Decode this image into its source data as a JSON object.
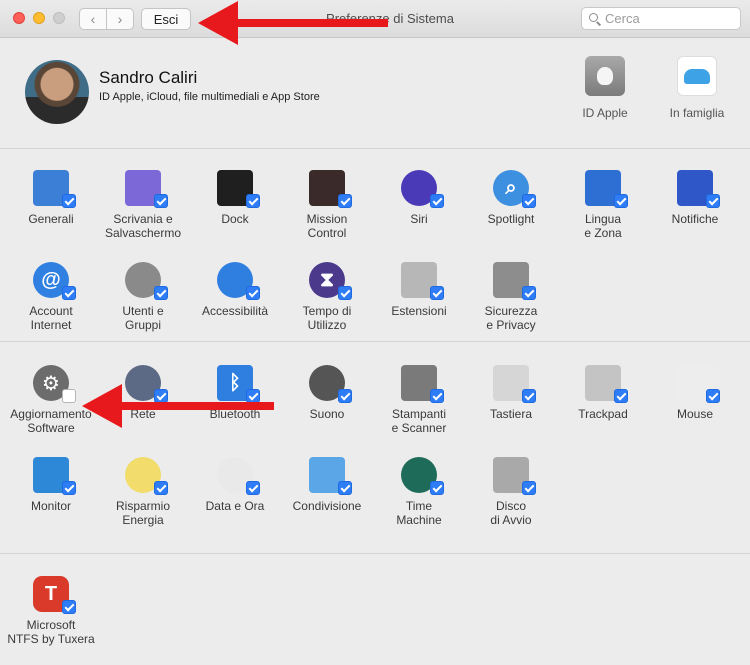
{
  "window": {
    "title": "Preferenze di Sistema",
    "back_glyph": "‹",
    "forward_glyph": "›",
    "quit_label": "Esci",
    "search_placeholder": "Cerca"
  },
  "account": {
    "name": "Sandro Caliri",
    "subtitle": "ID Apple, iCloud, file multimediali e App Store",
    "items": [
      {
        "label": "ID Apple",
        "icon": "apple-id-icon"
      },
      {
        "label": "In famiglia",
        "icon": "family-sharing-icon"
      }
    ]
  },
  "sections": [
    {
      "panes": [
        {
          "label": "Generali",
          "icon": "general-icon",
          "color": "#3b7fd6",
          "shape": "rect",
          "glyph": "",
          "checked": true
        },
        {
          "label": "Scrivania e\nSalvaschermo",
          "icon": "desktop-icon",
          "color": "#7d68d8",
          "shape": "rect",
          "glyph": "",
          "checked": true
        },
        {
          "label": "Dock",
          "icon": "dock-icon",
          "color": "#1f1f1f",
          "shape": "rect",
          "glyph": "",
          "checked": true
        },
        {
          "label": "Mission\nControl",
          "icon": "mission-control-icon",
          "color": "#3a2a2a",
          "shape": "rect",
          "glyph": "",
          "checked": true
        },
        {
          "label": "Siri",
          "icon": "siri-icon",
          "color": "#4a3ab8",
          "shape": "circle",
          "glyph": "",
          "checked": true
        },
        {
          "label": "Spotlight",
          "icon": "spotlight-icon",
          "color": "#3d8fe0",
          "shape": "circle",
          "glyph": "⌕",
          "checked": true
        },
        {
          "label": "Lingua\ne Zona",
          "icon": "language-icon",
          "color": "#2d6fd2",
          "shape": "rect",
          "glyph": "",
          "checked": true
        },
        {
          "label": "Notifiche",
          "icon": "notifications-icon",
          "color": "#2f57c8",
          "shape": "rect",
          "glyph": "",
          "checked": true
        },
        {
          "label": "Account\nInternet",
          "icon": "internet-accounts-icon",
          "color": "#2f80e0",
          "shape": "circle",
          "glyph": "@",
          "checked": true
        },
        {
          "label": "Utenti e\nGruppi",
          "icon": "users-groups-icon",
          "color": "#8a8a8a",
          "shape": "circle",
          "glyph": "",
          "checked": true
        },
        {
          "label": "Accessibilità",
          "icon": "accessibility-icon",
          "color": "#2f7fe0",
          "shape": "circle",
          "glyph": "",
          "checked": true
        },
        {
          "label": "Tempo di\nUtilizzo",
          "icon": "screen-time-icon",
          "color": "#4b3a8c",
          "shape": "circle",
          "glyph": "⧗",
          "checked": true
        },
        {
          "label": "Estensioni",
          "icon": "extensions-icon",
          "color": "#b7b7b7",
          "shape": "rect",
          "glyph": "",
          "checked": true
        },
        {
          "label": "Sicurezza\ne Privacy",
          "icon": "security-icon",
          "color": "#8d8d8d",
          "shape": "rect",
          "glyph": "",
          "checked": true
        }
      ]
    },
    {
      "panes": [
        {
          "label": "Aggiornamento\nSoftware",
          "icon": "software-update-icon",
          "color": "#6c6c6c",
          "shape": "circle",
          "glyph": "⚙",
          "checked": false
        },
        {
          "label": "Rete",
          "icon": "network-icon",
          "color": "#5d6a86",
          "shape": "circle",
          "glyph": "",
          "checked": true
        },
        {
          "label": "Bluetooth",
          "icon": "bluetooth-icon",
          "color": "#2f7fe0",
          "shape": "rect",
          "glyph": "ᛒ",
          "checked": true
        },
        {
          "label": "Suono",
          "icon": "sound-icon",
          "color": "#555555",
          "shape": "circle",
          "glyph": "",
          "checked": true
        },
        {
          "label": "Stampanti\ne Scanner",
          "icon": "printer-icon",
          "color": "#7a7a7a",
          "shape": "rect",
          "glyph": "",
          "checked": true
        },
        {
          "label": "Tastiera",
          "icon": "keyboard-icon",
          "color": "#d6d6d6",
          "shape": "rect",
          "glyph": "",
          "checked": true
        },
        {
          "label": "Trackpad",
          "icon": "trackpad-icon",
          "color": "#c4c4c4",
          "shape": "rect",
          "glyph": "",
          "checked": true
        },
        {
          "label": "Mouse",
          "icon": "mouse-icon",
          "color": "#ededed",
          "shape": "rect",
          "glyph": "",
          "checked": true
        },
        {
          "label": "Monitor",
          "icon": "displays-icon",
          "color": "#2e88d8",
          "shape": "rect",
          "glyph": "",
          "checked": true
        },
        {
          "label": "Risparmio\nEnergia",
          "icon": "energy-saver-icon",
          "color": "#f2dc6b",
          "shape": "circle",
          "glyph": "",
          "checked": true
        },
        {
          "label": "Data e Ora",
          "icon": "date-time-icon",
          "color": "#e9e9e9",
          "shape": "circle",
          "glyph": "",
          "checked": true
        },
        {
          "label": "Condivisione",
          "icon": "sharing-icon",
          "color": "#5aa6e6",
          "shape": "rect",
          "glyph": "",
          "checked": true
        },
        {
          "label": "Time\nMachine",
          "icon": "time-machine-icon",
          "color": "#1f6b5a",
          "shape": "circle",
          "glyph": "",
          "checked": true
        },
        {
          "label": "Disco\ndi Avvio",
          "icon": "startup-disk-icon",
          "color": "#a9a9a9",
          "shape": "rect",
          "glyph": "",
          "checked": true
        }
      ]
    },
    {
      "panes": [
        {
          "label": "Microsoft\nNTFS by Tuxera",
          "icon": "tuxera-ntfs-icon",
          "color": "#d93a2a",
          "shape": "squircle",
          "glyph": "T",
          "checked": true
        }
      ]
    }
  ]
}
